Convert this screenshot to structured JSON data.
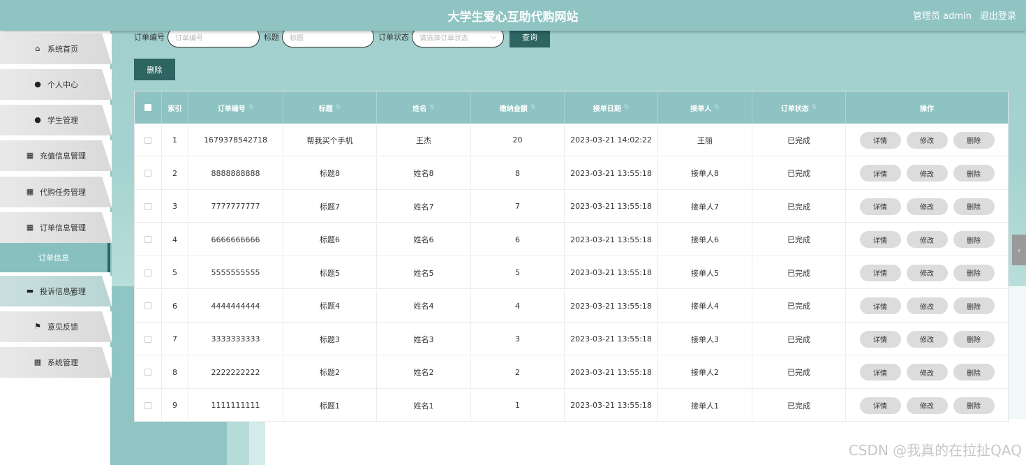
{
  "header": {
    "title": "大学生爱心互助代购网站",
    "user_role": "管理员 admin",
    "logout": "退出登录"
  },
  "sidebar": {
    "items": [
      {
        "label": "系统首页",
        "icon": "home-icon"
      },
      {
        "label": "个人中心",
        "icon": "user-icon"
      },
      {
        "label": "学生管理",
        "icon": "user-icon"
      },
      {
        "label": "充值信息管理",
        "icon": "grid-icon"
      },
      {
        "label": "代购任务管理",
        "icon": "grid-icon"
      },
      {
        "label": "订单信息管理",
        "icon": "grid-icon"
      },
      {
        "label": "投诉信息管理",
        "icon": "briefcase-icon"
      },
      {
        "label": "意见反馈",
        "icon": "flag-icon"
      },
      {
        "label": "系统管理",
        "icon": "grid-icon"
      }
    ],
    "submenu_active": "订单信息"
  },
  "search": {
    "order_no_label": "订单编号",
    "order_no_placeholder": "订单编号",
    "title_label": "标题",
    "title_placeholder": "标题",
    "status_label": "订单状态",
    "status_placeholder": "请选择订单状态",
    "query_button": "查询"
  },
  "toolbar": {
    "delete_button": "删除"
  },
  "table": {
    "headers": [
      "索引",
      "订单编号",
      "标题",
      "姓名",
      "缴纳金额",
      "接单日期",
      "接单人",
      "订单状态",
      "操作"
    ],
    "rows": [
      {
        "idx": "1",
        "no": "1679378542718",
        "title": "帮我买个手机",
        "name": "王杰",
        "amount": "20",
        "date": "2023-03-21 14:02:22",
        "taker": "王丽",
        "status": "已完成"
      },
      {
        "idx": "2",
        "no": "8888888888",
        "title": "标题8",
        "name": "姓名8",
        "amount": "8",
        "date": "2023-03-21 13:55:18",
        "taker": "接单人8",
        "status": "已完成"
      },
      {
        "idx": "3",
        "no": "7777777777",
        "title": "标题7",
        "name": "姓名7",
        "amount": "7",
        "date": "2023-03-21 13:55:18",
        "taker": "接单人7",
        "status": "已完成"
      },
      {
        "idx": "4",
        "no": "6666666666",
        "title": "标题6",
        "name": "姓名6",
        "amount": "6",
        "date": "2023-03-21 13:55:18",
        "taker": "接单人6",
        "status": "已完成"
      },
      {
        "idx": "5",
        "no": "5555555555",
        "title": "标题5",
        "name": "姓名5",
        "amount": "5",
        "date": "2023-03-21 13:55:18",
        "taker": "接单人5",
        "status": "已完成"
      },
      {
        "idx": "6",
        "no": "4444444444",
        "title": "标题4",
        "name": "姓名4",
        "amount": "4",
        "date": "2023-03-21 13:55:18",
        "taker": "接单人4",
        "status": "已完成"
      },
      {
        "idx": "7",
        "no": "3333333333",
        "title": "标题3",
        "name": "姓名3",
        "amount": "3",
        "date": "2023-03-21 13:55:18",
        "taker": "接单人3",
        "status": "已完成"
      },
      {
        "idx": "8",
        "no": "2222222222",
        "title": "标题2",
        "name": "姓名2",
        "amount": "2",
        "date": "2023-03-21 13:55:18",
        "taker": "接单人2",
        "status": "已完成"
      },
      {
        "idx": "9",
        "no": "1111111111",
        "title": "标题1",
        "name": "姓名1",
        "amount": "1",
        "date": "2023-03-21 13:55:18",
        "taker": "接单人1",
        "status": "已完成"
      }
    ],
    "actions": {
      "detail": "详情",
      "edit": "修改",
      "delete": "删除"
    }
  },
  "watermark": "CSDN @我真的在拉扯QAQ",
  "colors": {
    "accent": "#2e6461",
    "header": "#8fc4c3",
    "table_header": "#8dc3c2"
  }
}
